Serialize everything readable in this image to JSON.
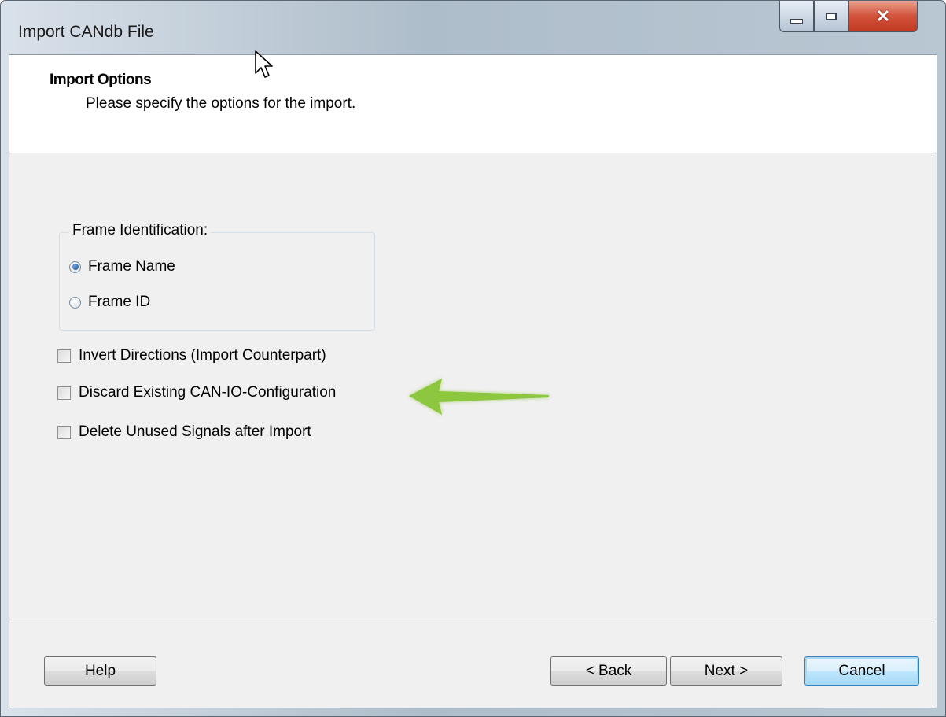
{
  "window": {
    "title": "Import CANdb File",
    "controls": {
      "minimize": "minimize-icon",
      "maximize": "maximize-icon",
      "close": "close-icon"
    }
  },
  "header": {
    "title": "Import Options",
    "subtitle": "Please specify the options for the import."
  },
  "frame_identification": {
    "legend": "Frame Identification:",
    "options": [
      {
        "label": "Frame Name",
        "selected": true
      },
      {
        "label": "Frame ID",
        "selected": false
      }
    ]
  },
  "checkboxes": [
    {
      "label": "Invert Directions (Import Counterpart)",
      "checked": false
    },
    {
      "label": "Discard Existing CAN-IO-Configuration",
      "checked": false
    },
    {
      "label": "Delete Unused Signals after Import",
      "checked": false
    }
  ],
  "buttons": {
    "help": "Help",
    "back": "< Back",
    "next": "Next >",
    "cancel": "Cancel"
  },
  "colors": {
    "annotation_arrow": "#8dc63f",
    "close_button": "#c9442b",
    "default_button_border": "#3c7fb1"
  }
}
